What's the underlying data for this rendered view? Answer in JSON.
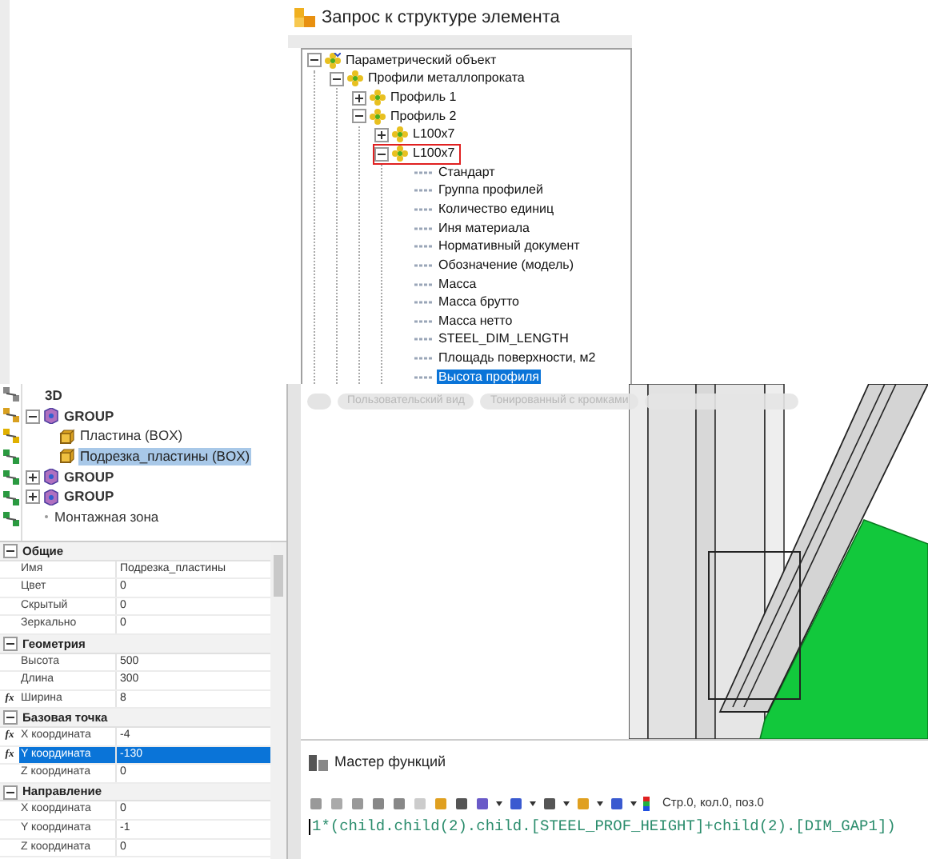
{
  "dialog": {
    "title": "Запрос к структуре элемента",
    "tree": [
      {
        "label": "Параметрический объект",
        "kind": "root",
        "expanded": true,
        "selected": false,
        "outlined": false,
        "children": [
          {
            "label": "Профили металлопроката",
            "kind": "object",
            "expanded": true,
            "selected": false,
            "outlined": false,
            "children": [
              {
                "label": "Профиль 1",
                "kind": "object",
                "expanded": false,
                "selected": false,
                "outlined": false
              },
              {
                "label": "Профиль 2",
                "kind": "object",
                "expanded": true,
                "selected": false,
                "outlined": false,
                "children": [
                  {
                    "label": "L100x7",
                    "kind": "object",
                    "expanded": false,
                    "selected": false,
                    "outlined": false
                  },
                  {
                    "label": "L100x7",
                    "kind": "object",
                    "expanded": true,
                    "selected": false,
                    "outlined": true,
                    "children": [
                      {
                        "label": "Стандарт",
                        "kind": "parameter",
                        "selected": false,
                        "outlined": false
                      },
                      {
                        "label": "Группа профилей",
                        "kind": "parameter",
                        "selected": false,
                        "outlined": false
                      },
                      {
                        "label": "Количество единиц",
                        "kind": "parameter",
                        "selected": false,
                        "outlined": false
                      },
                      {
                        "label": "Иня материала",
                        "kind": "parameter",
                        "selected": false,
                        "outlined": false
                      },
                      {
                        "label": "Нормативный документ",
                        "kind": "parameter",
                        "selected": false,
                        "outlined": false
                      },
                      {
                        "label": "Обозначение (модель)",
                        "kind": "parameter",
                        "selected": false,
                        "outlined": false
                      },
                      {
                        "label": "Масса",
                        "kind": "parameter",
                        "selected": false,
                        "outlined": false
                      },
                      {
                        "label": "Масса брутто",
                        "kind": "parameter",
                        "selected": false,
                        "outlined": false
                      },
                      {
                        "label": "Масса нетто",
                        "kind": "parameter",
                        "selected": false,
                        "outlined": false
                      },
                      {
                        "label": "STEEL_DIM_LENGTH",
                        "kind": "parameter",
                        "selected": false,
                        "outlined": false
                      },
                      {
                        "label": "Площадь поверхности, м2",
                        "kind": "parameter",
                        "selected": false,
                        "outlined": false
                      },
                      {
                        "label": "Высота профиля",
                        "kind": "parameter",
                        "selected": true,
                        "outlined": false
                      }
                    ]
                  }
                ]
              }
            ]
          }
        ]
      }
    ]
  },
  "model_tree": [
    {
      "label": "3D",
      "kind": "root",
      "selected": false
    },
    {
      "label": "GROUP",
      "kind": "group",
      "expanded": true,
      "selected": false,
      "children": [
        {
          "label": "Пластина (BOX)",
          "kind": "box",
          "selected": false
        },
        {
          "label": "Подрезка_пластины (BOX)",
          "kind": "box",
          "selected": true
        }
      ]
    },
    {
      "label": "GROUP",
      "kind": "group",
      "expanded": false,
      "selected": false
    },
    {
      "label": "GROUP",
      "kind": "group",
      "expanded": false,
      "selected": false
    },
    {
      "label": "Монтажная зона",
      "kind": "zone",
      "selected": false
    }
  ],
  "properties": [
    {
      "title": "Общие",
      "expanded": true,
      "rows": [
        {
          "name": "Имя",
          "value": "Подрезка_пластины",
          "selected": false
        },
        {
          "name": "Цвет",
          "value": "0",
          "selected": false
        },
        {
          "name": "Скрытый",
          "value": "0",
          "selected": false
        },
        {
          "name": "Зеркально",
          "value": "0",
          "selected": false
        }
      ]
    },
    {
      "title": "Геометрия",
      "expanded": true,
      "rows": [
        {
          "name": "Высота",
          "value": "500",
          "selected": false
        },
        {
          "name": "Длина",
          "value": "300",
          "selected": false
        },
        {
          "name": "Ширина",
          "value": "8",
          "badge": "fx",
          "selected": false
        }
      ]
    },
    {
      "title": "Базовая точка",
      "expanded": true,
      "rows": [
        {
          "name": "X координата",
          "value": "-4",
          "badge": "fx",
          "selected": false
        },
        {
          "name": "Y координата",
          "value": "-130",
          "badge": "fx",
          "selected": true
        },
        {
          "name": "Z координата",
          "value": "0",
          "selected": false
        }
      ]
    },
    {
      "title": "Направление",
      "expanded": true,
      "rows": [
        {
          "name": "X координата",
          "value": "0",
          "selected": false
        },
        {
          "name": "Y координата",
          "value": "-1",
          "selected": false
        },
        {
          "name": "Z координата",
          "value": "0",
          "selected": false
        }
      ]
    }
  ],
  "viewport": {
    "view_tabs": [
      "Пользовательский вид",
      "Тонированный с кромками"
    ]
  },
  "function_wizard": {
    "title": "Мастер функций",
    "cursor_position": "Стр.0, кол.0, поз.0",
    "formula": "1*(child.child(2).child.[STEEL_PROF_HEIGHT]+child(2).[DIM_GAP1])"
  }
}
